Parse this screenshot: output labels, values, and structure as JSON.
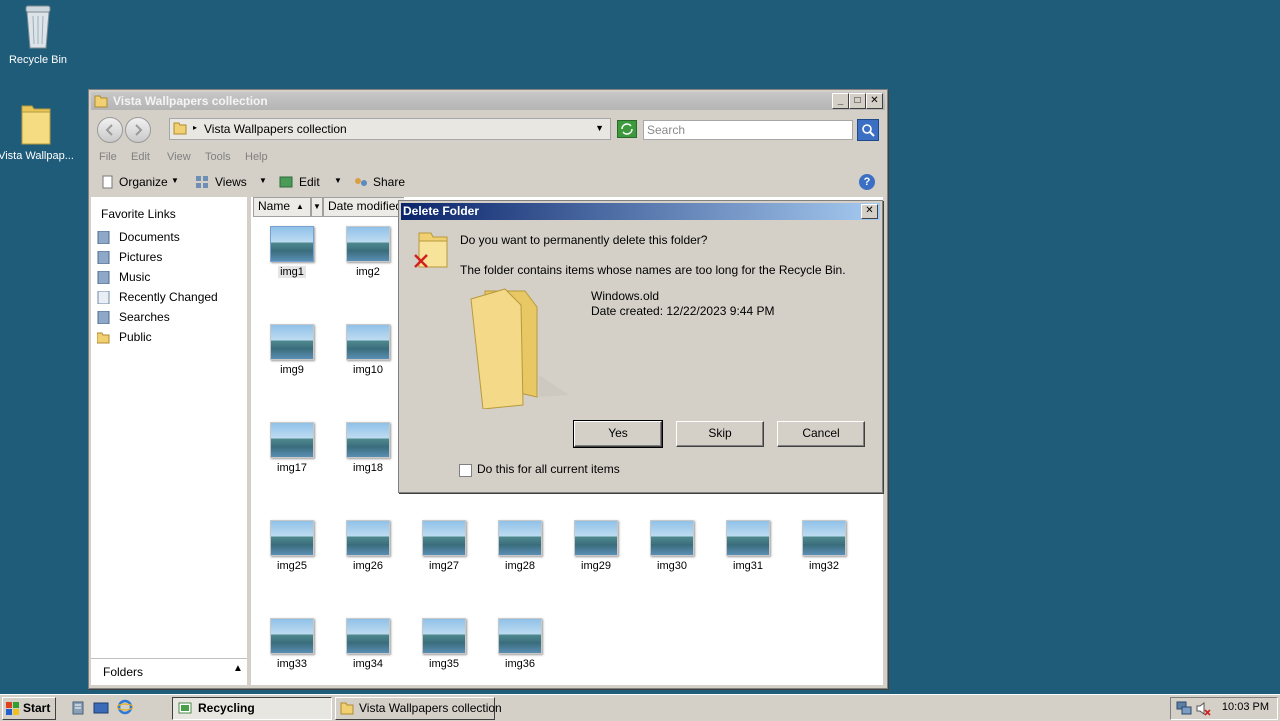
{
  "desktop": {
    "icons": [
      {
        "label": "Recycle Bin"
      },
      {
        "label": "Vista Wallpap..."
      }
    ]
  },
  "explorer": {
    "title": "Vista Wallpapers collection",
    "address": "Vista Wallpapers collection",
    "search_placeholder": "Search",
    "menu": [
      "File",
      "Edit",
      "View",
      "Tools",
      "Help"
    ],
    "toolbar": {
      "organize": "Organize",
      "views": "Views",
      "edit": "Edit",
      "share": "Share"
    },
    "favorites_header": "Favorite Links",
    "favorites": [
      "Documents",
      "Pictures",
      "Music",
      "Recently Changed",
      "Searches",
      "Public"
    ],
    "folders_label": "Folders",
    "columns": [
      "Name",
      "Date modified"
    ],
    "files": [
      "img1",
      "img2",
      "img9",
      "img10",
      "img17",
      "img18",
      "img25",
      "img26",
      "img27",
      "img28",
      "img29",
      "img30",
      "img31",
      "img32",
      "img33",
      "img34",
      "img35",
      "img36"
    ]
  },
  "dialog": {
    "title": "Delete Folder",
    "question": "Do you want to permanently delete this folder?",
    "detail": "The folder contains items whose names are too long for the Recycle Bin.",
    "item_name": "Windows.old",
    "item_date": "Date created: 12/22/2023 9:44 PM",
    "yes": "Yes",
    "skip": "Skip",
    "cancel": "Cancel",
    "apply_all": "Do this for all current items"
  },
  "taskbar": {
    "start": "Start",
    "tasks": [
      "Recycling",
      "Vista Wallpapers collection"
    ],
    "clock": "10:03 PM"
  }
}
